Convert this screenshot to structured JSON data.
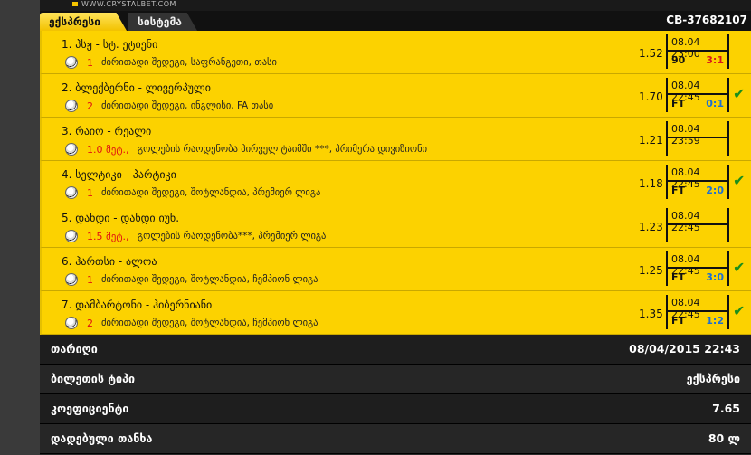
{
  "site": {
    "logo_text": "WWW.CRYSTALBET.COM"
  },
  "tabs": [
    {
      "label": "ექსპრესი",
      "active": true
    },
    {
      "label": "სისტემა",
      "active": false
    }
  ],
  "ticket_id": "CB-37682107",
  "bets": [
    {
      "title": "1. პსჟ - სტ. ეტიენი",
      "pick": "1",
      "market": "ძირითადი შედეგი, საფრანგეთი, თასი",
      "odd": "1.52",
      "date": "08.04 23:00",
      "status": "90",
      "score": "3:1",
      "score_color": "red",
      "won": false
    },
    {
      "title": "2. ბლექბერნი - ლივერპული",
      "pick": "2",
      "market": "ძირითადი შედეგი, ინგლისი, FA თასი",
      "odd": "1.70",
      "date": "08.04 22:45",
      "status": "FT",
      "score": "0:1",
      "score_color": "blue",
      "won": true
    },
    {
      "title": "3. რაიო - რეალი",
      "pick": "1.0 მეტ.,",
      "market": "გოლების რაოდენობა პირველ ტაიმში ***, პრიმერა დივიზიონი",
      "odd": "1.21",
      "date": "08.04 23:59",
      "status": "",
      "score": "",
      "score_color": "blue",
      "won": false
    },
    {
      "title": "4. სელტიკი - პარტიკი",
      "pick": "1",
      "market": "ძირითადი შედეგი, შოტლანდია, პრემიერ ლიგა",
      "odd": "1.18",
      "date": "08.04 22:45",
      "status": "FT",
      "score": "2:0",
      "score_color": "blue",
      "won": true
    },
    {
      "title": "5. დანდი - დანდი იუნ.",
      "pick": "1.5 მეტ.,",
      "market": "გოლების რაოდენობა***, პრემიერ ლიგა",
      "odd": "1.23",
      "date": "08.04 22:45",
      "status": "",
      "score": "",
      "score_color": "blue",
      "won": false
    },
    {
      "title": "6. ჰართსი - ალოა",
      "pick": "1",
      "market": "ძირითადი შედეგი, შოტლანდია, ჩემპიონ ლიგა",
      "odd": "1.25",
      "date": "08.04 22:45",
      "status": "FT",
      "score": "3:0",
      "score_color": "blue",
      "won": true
    },
    {
      "title": "7. დამბარტონი - ჰიბერნიანი",
      "pick": "2",
      "market": "ძირითადი შედეგი, შოტლანდია, ჩემპიონ ლიგა",
      "odd": "1.35",
      "date": "08.04 22:45",
      "status": "FT",
      "score": "1:2",
      "score_color": "blue",
      "won": true
    }
  ],
  "info": [
    {
      "label": "თარიღი",
      "value": "08/04/2015 22:43"
    },
    {
      "label": "ბილეთის ტიპი",
      "value": "ექსპრესი"
    },
    {
      "label": "კოეფიციენტი",
      "value": "7.65"
    },
    {
      "label": "დადებული თანხა",
      "value": "80 ლ"
    }
  ],
  "colors": {
    "row_bg": "#fcd200",
    "win_check": "#1b8f1b",
    "live_score": "#d81a1a",
    "final_score": "#1e6fd0"
  },
  "icons": {
    "sport": "soccer-ball-icon",
    "won": "check-icon"
  }
}
